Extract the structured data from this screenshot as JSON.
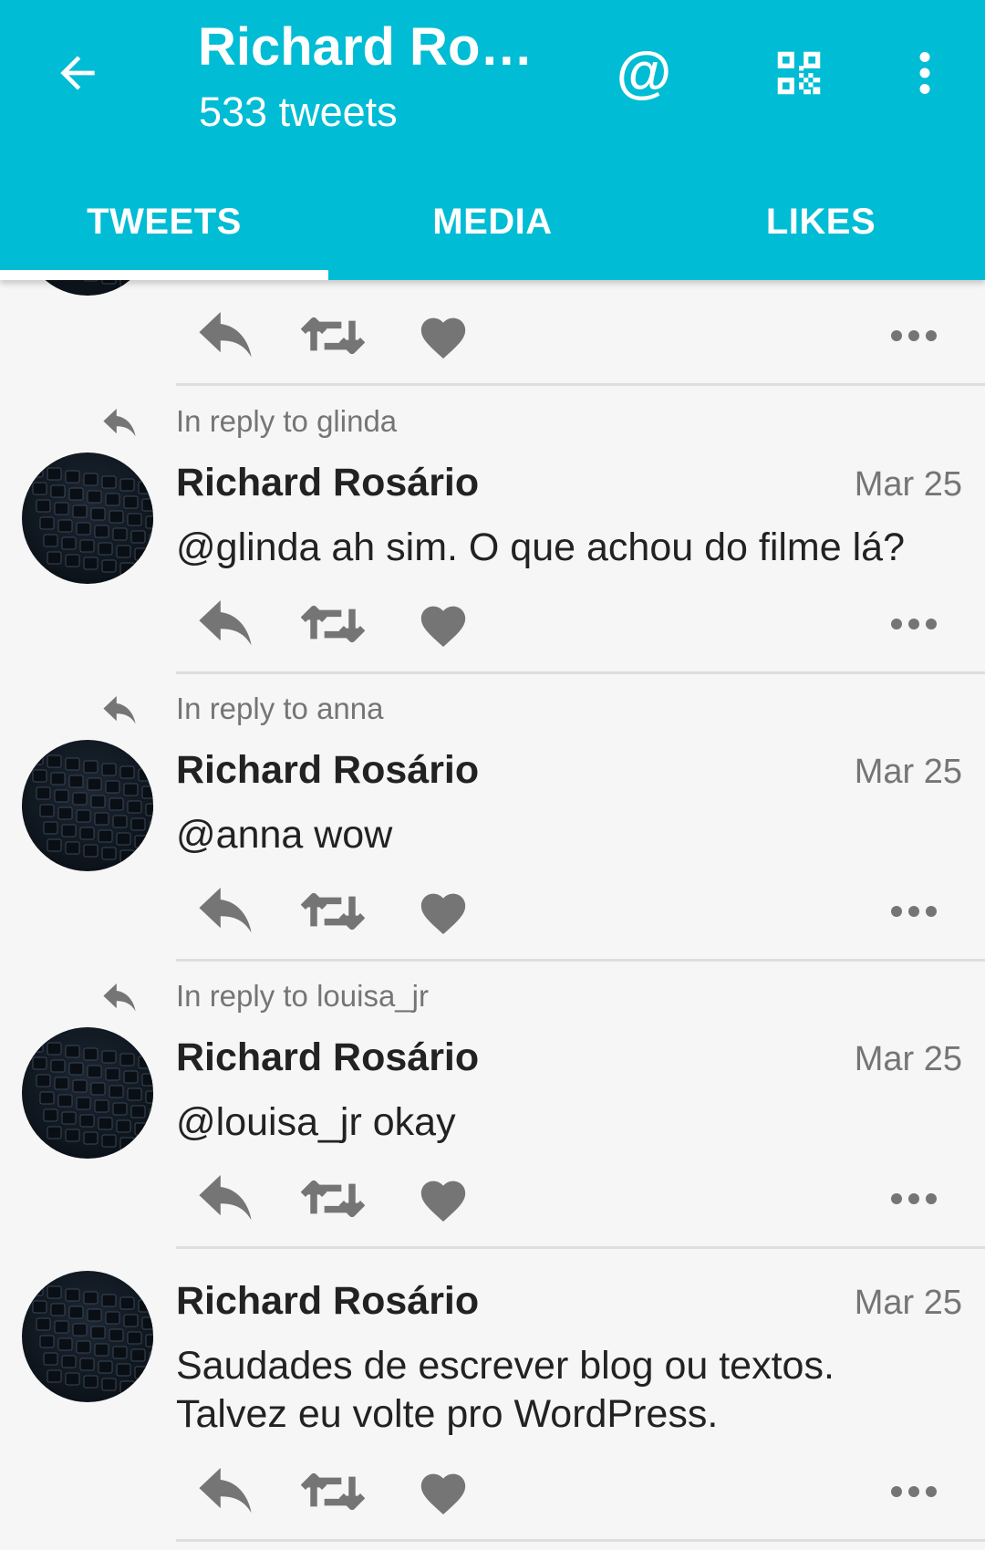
{
  "header": {
    "title": "Richard Rosário",
    "subtitle": "533 tweets",
    "tabs": [
      "TWEETS",
      "MEDIA",
      "LIKES"
    ],
    "active_tab": "TWEETS",
    "accent_color": "#00bcd4"
  },
  "icons": {
    "back": "arrow-left-icon",
    "mention": "at-sign-icon",
    "qr": "qr-code-icon",
    "menu": "more-vert-icon",
    "reply": "reply-icon",
    "retweet": "retweet-icon",
    "like": "heart-icon",
    "more": "more-horiz-icon"
  },
  "tweets": [
    {
      "reply_to": "In reply to glinda",
      "author": "Richard Rosário",
      "date": "Mar 25",
      "text": "@glinda ah sim. O que achou do filme lá?"
    },
    {
      "reply_to": "In reply to anna",
      "author": "Richard Rosário",
      "date": "Mar 25",
      "text": "@anna wow"
    },
    {
      "reply_to": "In reply to louisa_jr",
      "author": "Richard Rosário",
      "date": "Mar 25",
      "text": "@louisa_jr okay"
    },
    {
      "reply_to": "",
      "author": "Richard Rosário",
      "date": "Mar 25",
      "text": "Saudades de escrever blog ou textos. Talvez eu volte pro WordPress."
    }
  ]
}
